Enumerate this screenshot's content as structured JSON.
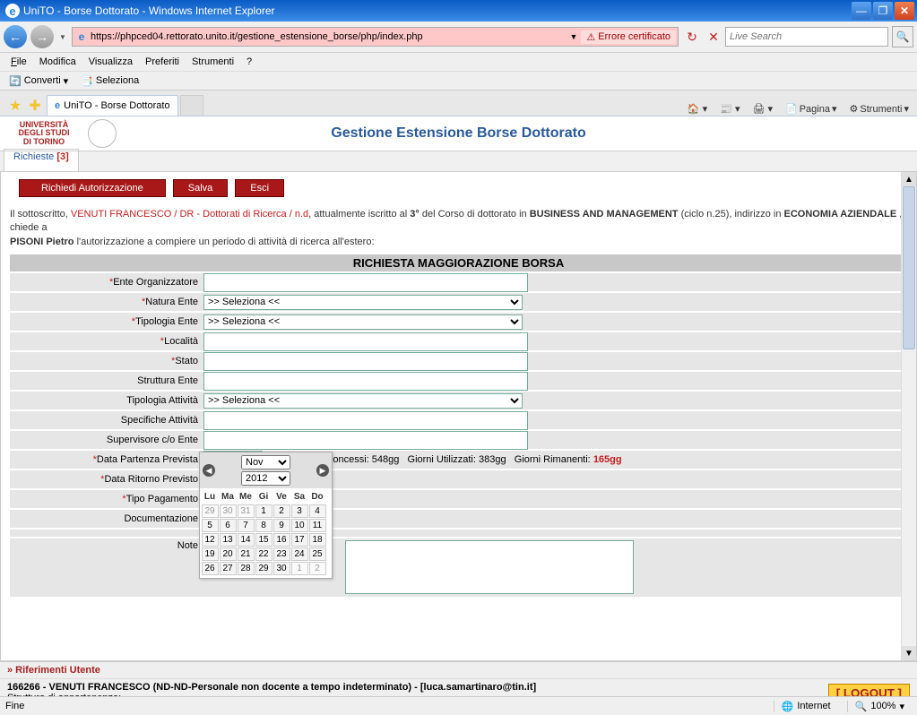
{
  "window": {
    "title": "UniTO - Borse Dottorato - Windows Internet Explorer",
    "url": "https://phpced04.rettorato.unito.it/gestione_estensione_borse/php/index.php",
    "cert_error": "Errore certificato",
    "search_placeholder": "Live Search"
  },
  "menu": {
    "file": "File",
    "edit": "Modifica",
    "view": "Visualizza",
    "fav": "Preferiti",
    "tools": "Strumenti",
    "help": "?"
  },
  "toolbar2": {
    "convert": "Converti",
    "select": "Seleziona"
  },
  "tab": {
    "title": "UniTO - Borse Dottorato"
  },
  "cmdbar": {
    "page": "Pagina",
    "tools": "Strumenti"
  },
  "app": {
    "title": "Gestione Estensione Borse Dottorato",
    "logo_line1": "UNIVERSITÀ",
    "logo_line2": "DEGLI STUDI",
    "logo_line3": "DI TORINO"
  },
  "apptab": {
    "label": "Richieste",
    "count": "[3]"
  },
  "buttons": {
    "request": "Richiedi Autorizzazione",
    "save": "Salva",
    "exit": "Esci"
  },
  "intro": {
    "t1": "Il sottoscritto, ",
    "user_path": "VENUTI FRANCESCO / DR - Dottorati di Ricerca / n.d",
    "t2": ", attualmente iscritto al ",
    "year": "3°",
    "t3": " del Corso di dottorato in ",
    "course": "BUSINESS AND MANAGEMENT",
    "t4": " (ciclo n.25), indirizzo in ",
    "indir": "ECONOMIA AZIENDALE",
    "t5": " , chiede a ",
    "tutor": "PISONI Pietro",
    "t6": " l'autorizzazione a compiere un periodo di attività di ricerca all'estero:"
  },
  "form": {
    "title": "RICHIESTA MAGGIORAZIONE BORSA",
    "fields": {
      "ente_org": "Ente Organizzatore",
      "natura_ente": "Natura Ente",
      "tipologia_ente": "Tipologia Ente",
      "localita": "Località",
      "stato": "Stato",
      "struttura_ente": "Struttura Ente",
      "tipologia_att": "Tipologia Attività",
      "specifiche_att": "Specifiche Attività",
      "supervisore": "Supervisore c/o Ente",
      "data_partenza": "Data Partenza Prevista",
      "data_ritorno": "Data Ritorno Previsto",
      "tipo_pagamento": "Tipo Pagamento",
      "documentazione": "Documentazione",
      "note": "Note"
    },
    "select_placeholder": ">> Seleziona <<",
    "days": {
      "concessi_lbl": "Giorni Concessi:",
      "concessi": "548gg",
      "utilizzati_lbl": "Giorni Utilizzati:",
      "utilizzati": "383gg",
      "rimanenti_lbl": "Giorni Rimanenti:",
      "rimanenti": "165gg"
    }
  },
  "datepicker": {
    "month": "Nov",
    "year": "2012",
    "dow": [
      "Lu",
      "Ma",
      "Me",
      "Gi",
      "Ve",
      "Sa",
      "Do"
    ],
    "weeks": [
      [
        {
          "d": "29",
          "o": true
        },
        {
          "d": "30",
          "o": true
        },
        {
          "d": "31",
          "o": true
        },
        {
          "d": "1"
        },
        {
          "d": "2"
        },
        {
          "d": "3"
        },
        {
          "d": "4"
        }
      ],
      [
        {
          "d": "5"
        },
        {
          "d": "6"
        },
        {
          "d": "7"
        },
        {
          "d": "8"
        },
        {
          "d": "9"
        },
        {
          "d": "10"
        },
        {
          "d": "11"
        }
      ],
      [
        {
          "d": "12"
        },
        {
          "d": "13"
        },
        {
          "d": "14"
        },
        {
          "d": "15"
        },
        {
          "d": "16"
        },
        {
          "d": "17"
        },
        {
          "d": "18"
        }
      ],
      [
        {
          "d": "19"
        },
        {
          "d": "20"
        },
        {
          "d": "21"
        },
        {
          "d": "22"
        },
        {
          "d": "23"
        },
        {
          "d": "24"
        },
        {
          "d": "25"
        }
      ],
      [
        {
          "d": "26"
        },
        {
          "d": "27"
        },
        {
          "d": "28"
        },
        {
          "d": "29"
        },
        {
          "d": "30"
        },
        {
          "d": "1",
          "o": true
        },
        {
          "d": "2",
          "o": true
        }
      ]
    ]
  },
  "footer": {
    "riferimenti": "» Riferimenti Utente",
    "user_line": "166266 - VENUTI FRANCESCO  (ND-ND-Personale non docente a tempo indeterminato) - [luca.samartinaro@tin.it]",
    "struttura_lbl": "Struttura di appartenenza:",
    "struttura_val": " - - - - -",
    "logout": "[ LOGOUT ]"
  },
  "status": {
    "left": "Fine",
    "zone": "Internet",
    "zoom": "100%"
  }
}
